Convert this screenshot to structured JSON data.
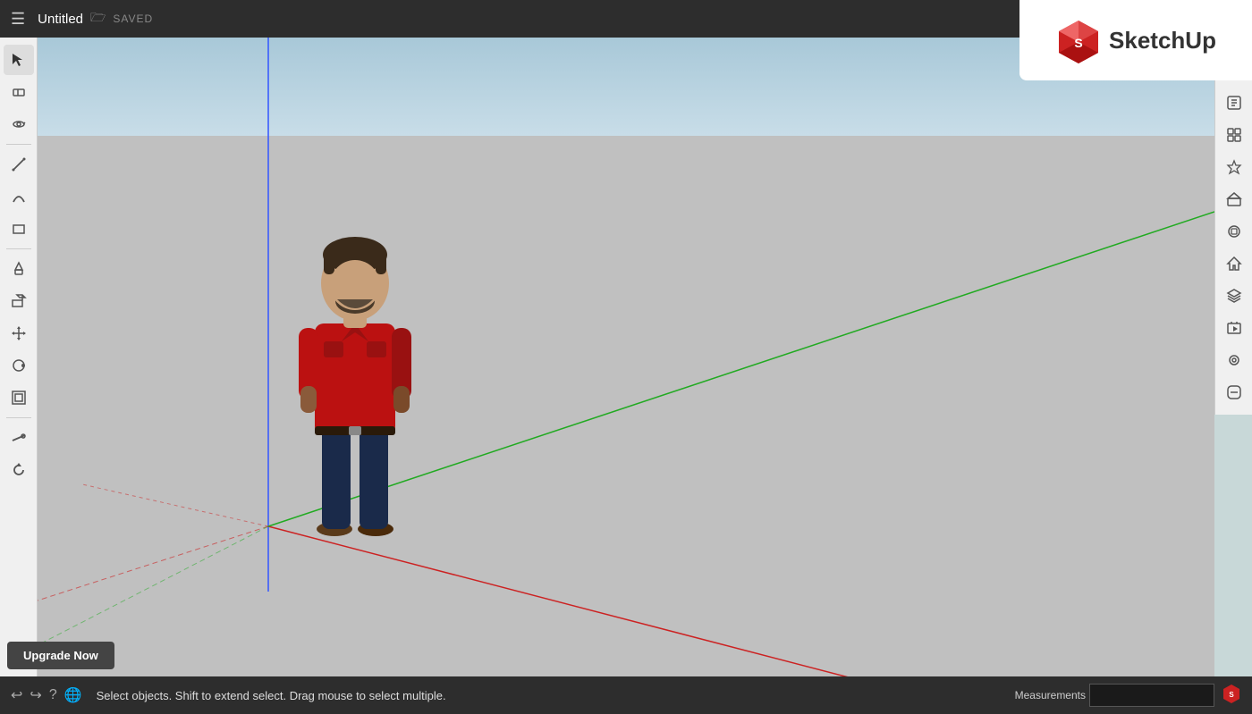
{
  "topbar": {
    "title": "Untitled",
    "save_icon": "💾",
    "saved_label": "SAVED"
  },
  "logo": {
    "text": "SketchUp"
  },
  "bottombar": {
    "status_text": "Select objects. Shift to extend select. Drag mouse to select multiple.",
    "measurements_label": "Measurements",
    "measurements_value": ""
  },
  "upgrade": {
    "label": "Upgrade Now"
  },
  "left_tools": [
    {
      "id": "select",
      "icon": "↖",
      "label": "Select"
    },
    {
      "id": "eraser",
      "icon": "◻",
      "label": "Eraser"
    },
    {
      "id": "orbit",
      "icon": "⊙",
      "label": "Orbit"
    },
    {
      "id": "line",
      "icon": "/",
      "label": "Line"
    },
    {
      "id": "arc",
      "icon": "⌒",
      "label": "Arc"
    },
    {
      "id": "rectangle",
      "icon": "▭",
      "label": "Rectangle"
    },
    {
      "id": "paint",
      "icon": "⬢",
      "label": "Paint Bucket"
    },
    {
      "id": "push-pull",
      "icon": "◱",
      "label": "Push/Pull"
    },
    {
      "id": "move",
      "icon": "✛",
      "label": "Move"
    },
    {
      "id": "follow-me",
      "icon": "◯",
      "label": "Follow Me"
    },
    {
      "id": "offset",
      "icon": "⊡",
      "label": "Offset"
    },
    {
      "id": "tape",
      "icon": "📏",
      "label": "Tape Measure"
    },
    {
      "id": "rotate",
      "icon": "↻",
      "label": "Rotate"
    }
  ],
  "right_tools": [
    {
      "id": "entity-info",
      "icon": "ℹ",
      "label": "Entity Info"
    },
    {
      "id": "components",
      "icon": "⊞",
      "label": "Components"
    },
    {
      "id": "styles",
      "icon": "🎓",
      "label": "Styles"
    },
    {
      "id": "shape",
      "icon": "⬡",
      "label": "Shape"
    },
    {
      "id": "3d-warehouse",
      "icon": "⬢",
      "label": "3D Warehouse"
    },
    {
      "id": "home",
      "icon": "⌂",
      "label": "Home"
    },
    {
      "id": "layers",
      "icon": "≡",
      "label": "Layers"
    },
    {
      "id": "scenes",
      "icon": "🎬",
      "label": "Scenes"
    },
    {
      "id": "match-photo",
      "icon": "◎",
      "label": "Match Photo"
    },
    {
      "id": "soften",
      "icon": "◈",
      "label": "Soften Edges"
    }
  ]
}
